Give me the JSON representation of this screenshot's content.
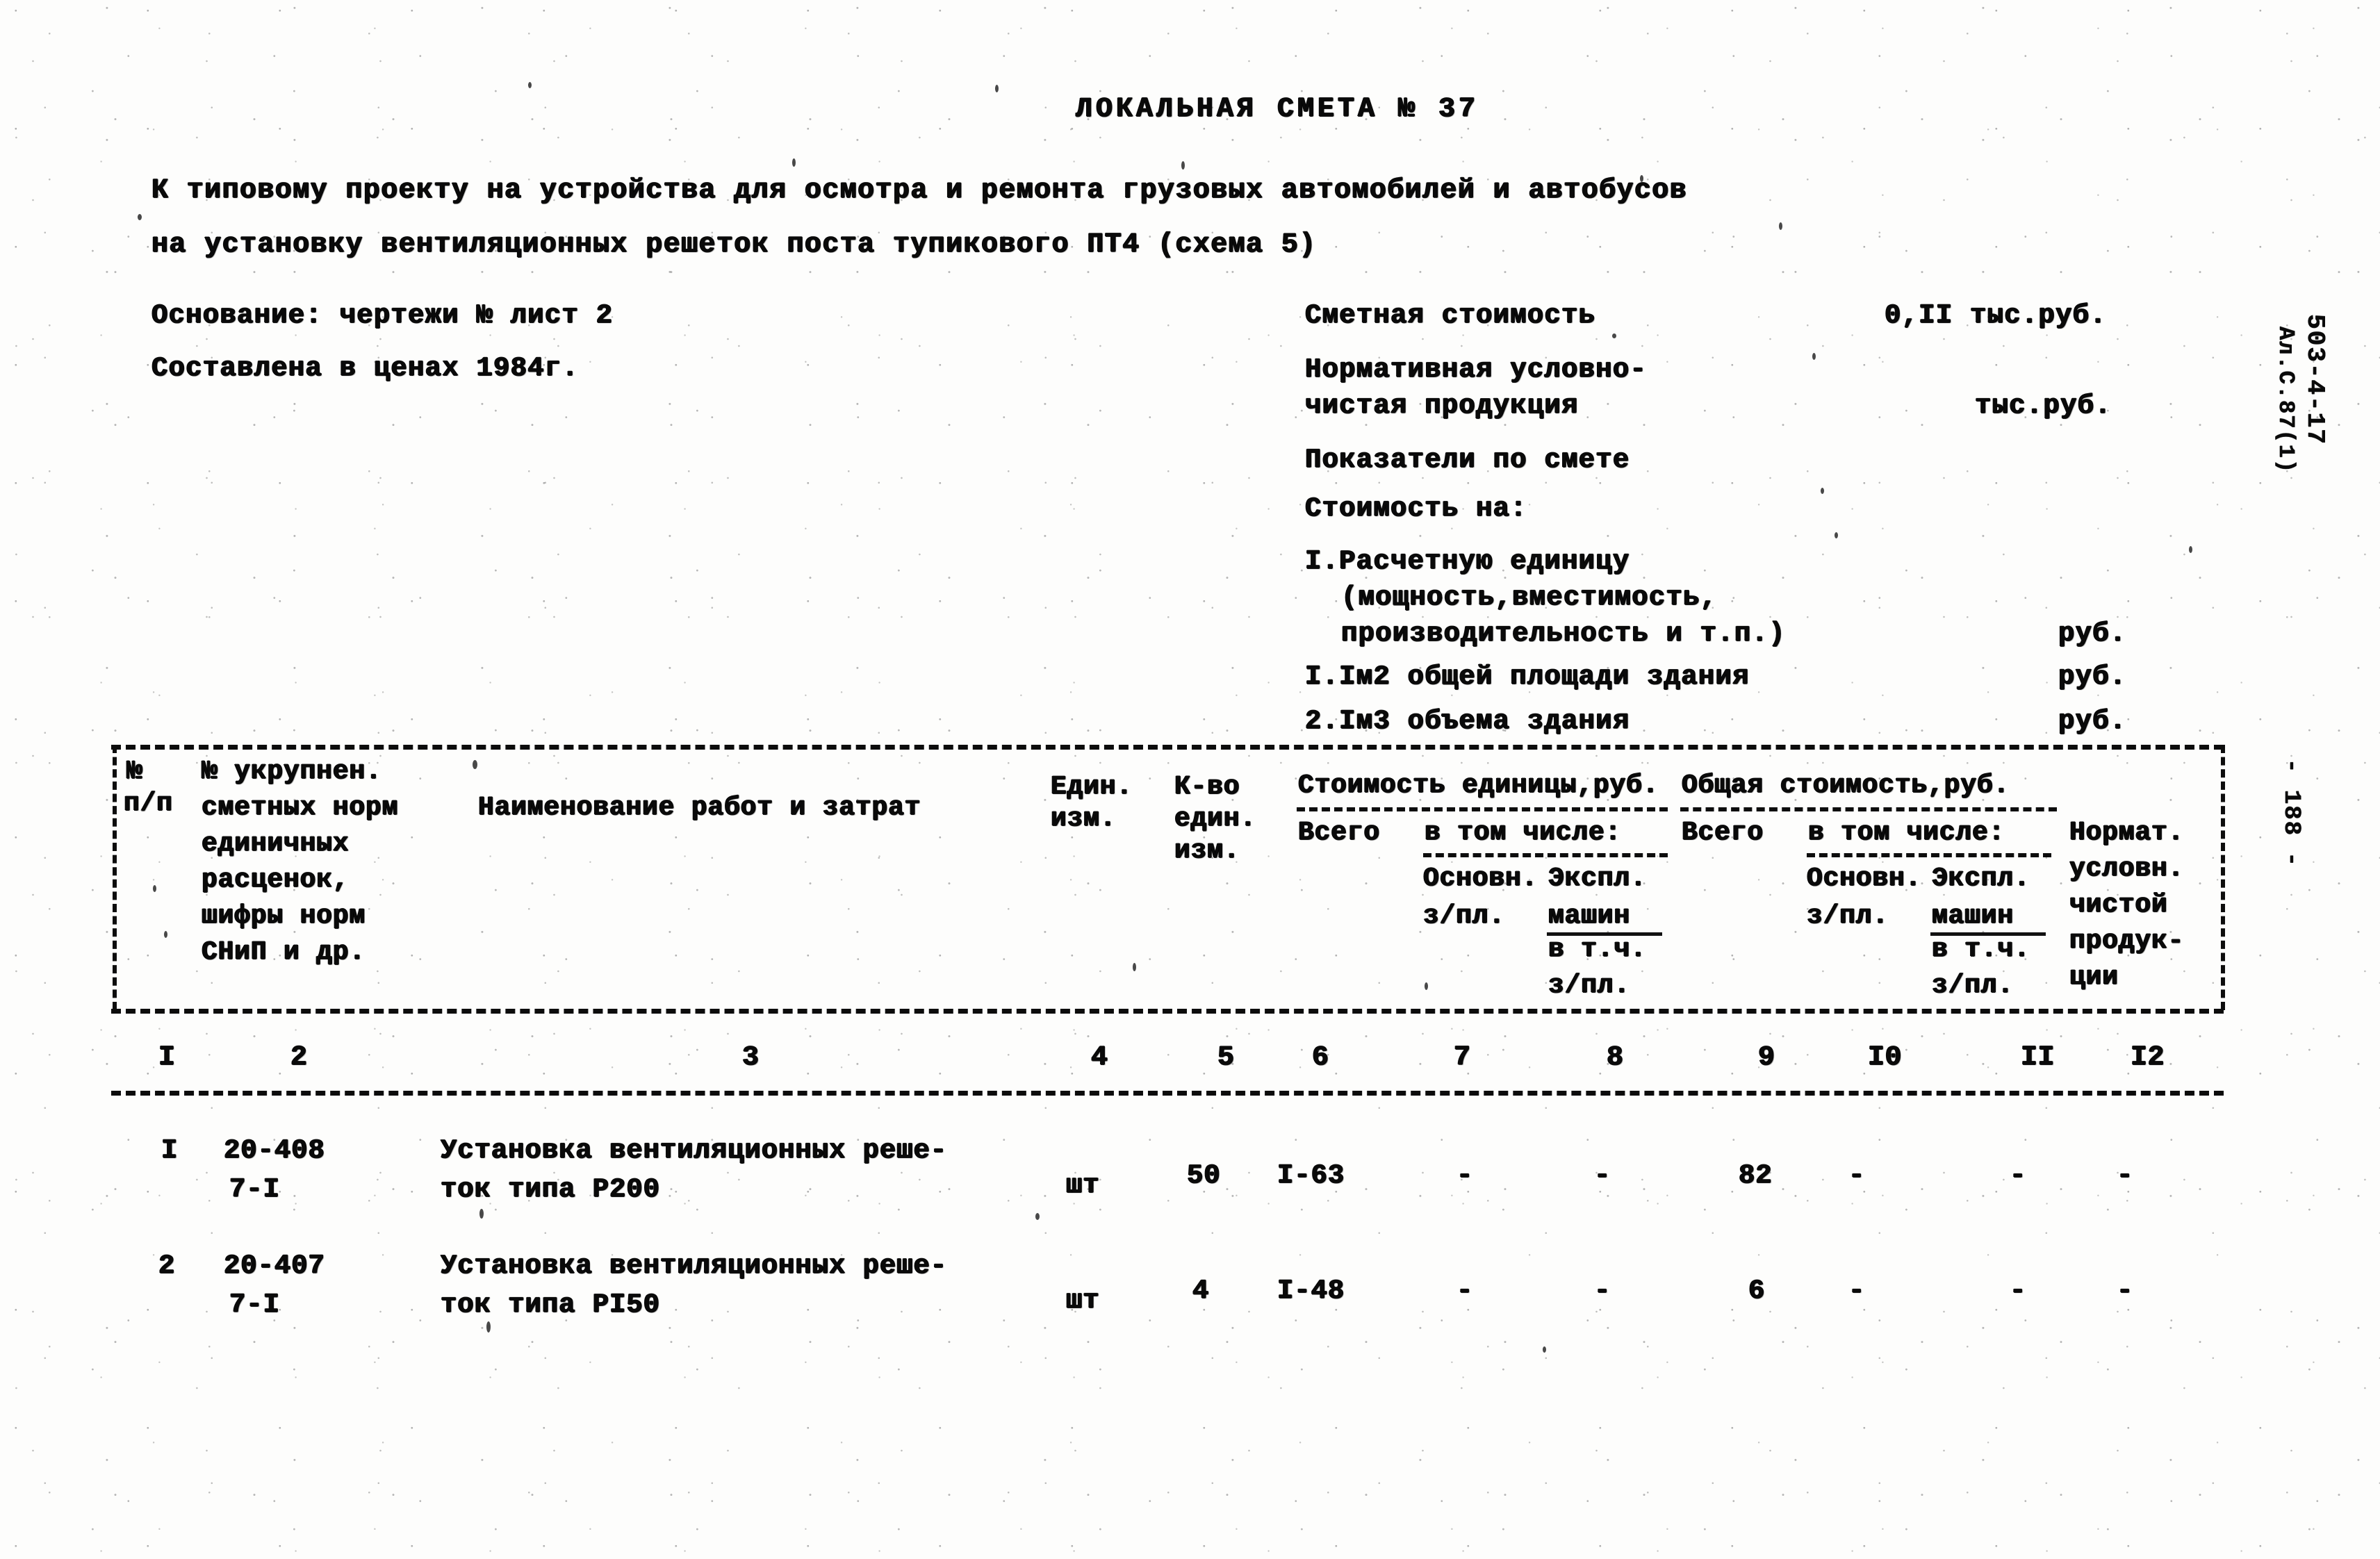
{
  "document": {
    "title": "ЛОКАЛЬНАЯ СМЕТА № 37",
    "subtitle_line1": "К типовому проекту на устройства для осмотра и ремонта грузовых автомобилей и автобусов",
    "subtitle_line2": "на установку вентиляционных решеток поста тупикового ПТ4 (схема 5)"
  },
  "meta_left": {
    "basis_label": "Основание: чертежи № лист 2",
    "prices_label": "Составлена в ценах 1984г."
  },
  "meta_right": {
    "estimate_cost_label": "Сметная стоимость",
    "estimate_cost_value": "0,II тыс.руб.",
    "npv_label_line1": "Нормативная условно-",
    "npv_label_line2": "чистая продукция",
    "npv_value": "тыс.руб.",
    "indicators_label": "Показатели по смете",
    "cost_per_label": "Стоимость на:",
    "items": [
      {
        "label_line1": "I.Расчетную единицу",
        "label_line2": "(мощность,вместимость,",
        "label_line3": "производительность и т.п.)",
        "unit": "руб."
      },
      {
        "label_line1": "I.Iм2 общей площади здания",
        "unit": "руб."
      },
      {
        "label_line1": "2.Iм3 объема здания",
        "unit": "руб."
      }
    ]
  },
  "margin": {
    "project_code_line1": "503-4-17",
    "project_code_line2": "Ал.С.87(1)",
    "page_number": "- 188 -"
  },
  "table": {
    "headers": {
      "col_no_line1": "№",
      "col_no_line2": "п/п",
      "norms_line1": "№ укрупнен.",
      "norms_line2": "сметных норм",
      "norms_line3": "единичных",
      "norms_line4": "расценок,",
      "norms_line5": "шифры норм",
      "norms_line6": "СНиП и др.",
      "description": "Наименование работ и затрат",
      "unit_line1": "Един.",
      "unit_line2": "изм.",
      "qty_line1": "К-во",
      "qty_line2": "един.",
      "qty_line3": "изм.",
      "unit_cost_group": "Стоимость единицы,руб.",
      "total_cost_group": "Общая стоимость,руб.",
      "total_word": "Всего",
      "including_word": "в том числе:",
      "basic_wage_line1": "Основн.",
      "basic_wage_line2": "з/пл.",
      "machine_line1": "Экспл.",
      "machine_line2": "машин",
      "machine_line3": "в т.ч.",
      "machine_line4": "з/пл.",
      "npv_line1": "Нормат.",
      "npv_line2": "условн.",
      "npv_line3": "чистой",
      "npv_line4": "продук-",
      "npv_line5": "ции"
    },
    "column_numbers": [
      "I",
      "2",
      "3",
      "4",
      "5",
      "6",
      "7",
      "8",
      "9",
      "I0",
      "II",
      "I2"
    ],
    "rows": [
      {
        "no": "I",
        "norm_line1": "20-408",
        "norm_line2": "7-I",
        "desc_line1": "Установка вентиляционных реше-",
        "desc_line2": "ток типа Р200",
        "unit": "шт",
        "qty": "50",
        "unit_total": "I-63",
        "unit_basic_wage": "-",
        "unit_machine": "-",
        "cost_total": "82",
        "cost_basic_wage": "-",
        "cost_machine": "-",
        "npv": "-"
      },
      {
        "no": "2",
        "norm_line1": "20-407",
        "norm_line2": "7-I",
        "desc_line1": "Установка вентиляционных реше-",
        "desc_line2": "ток типа РI50",
        "unit": "шт",
        "qty": "4",
        "unit_total": "I-48",
        "unit_basic_wage": "-",
        "unit_machine": "-",
        "cost_total": "6",
        "cost_basic_wage": "-",
        "cost_machine": "-",
        "npv": "-"
      }
    ]
  }
}
